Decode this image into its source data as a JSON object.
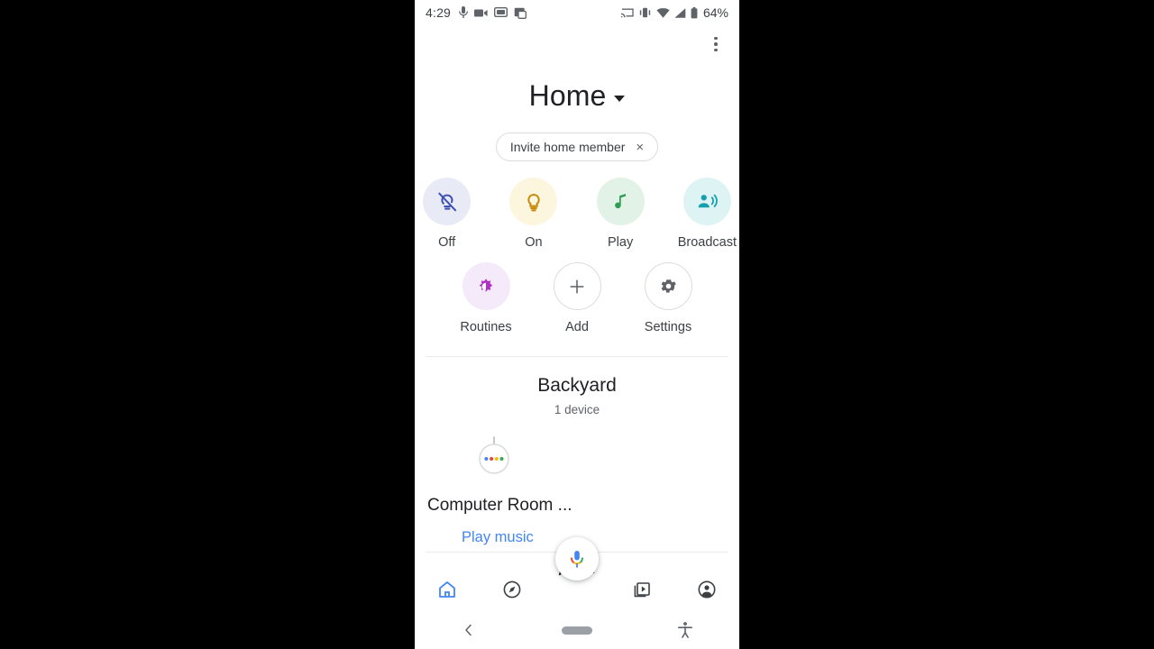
{
  "statusbar": {
    "clock": "4:29",
    "battery_text": "64%",
    "left_icons": [
      "mic-muted-icon",
      "video-camera-icon",
      "screen-record-icon",
      "screenshot-icon"
    ],
    "right_icons": [
      "cast-icon",
      "vibrate-icon",
      "wifi-icon",
      "cellular-signal-icon",
      "battery-icon"
    ]
  },
  "header": {
    "overflow_label": "more-options",
    "title": "Home",
    "caret": "chevron-down-icon"
  },
  "invite_chip": {
    "label": "Invite home member",
    "close": "×"
  },
  "quick_actions_row1": [
    {
      "label": "Off",
      "icon": "lightbulb-off-icon",
      "bg": "#e8ebf5",
      "fg": "#3f51b5"
    },
    {
      "label": "On",
      "icon": "lightbulb-on-icon",
      "bg": "#fdf6de",
      "fg": "#c8890a"
    },
    {
      "label": "Play",
      "icon": "music-note-icon",
      "bg": "#e3f2e7",
      "fg": "#2e9e52"
    },
    {
      "label": "Broadcast",
      "icon": "person-speaking-icon",
      "bg": "#def3f4",
      "fg": "#16a0ae"
    }
  ],
  "quick_actions_row2": [
    {
      "label": "Routines",
      "icon": "routines-brightness-icon",
      "bg": "#f4eafa",
      "fg": "#b02fc4",
      "outline": false
    },
    {
      "label": "Add",
      "icon": "plus-icon",
      "bg": "#ffffff",
      "fg": "#5f6368",
      "outline": true
    },
    {
      "label": "Settings",
      "icon": "gear-icon",
      "bg": "#ffffff",
      "fg": "#5f6368",
      "outline": true
    }
  ],
  "room": {
    "title": "Backyard",
    "subtitle": "1 device"
  },
  "device": {
    "icon": "google-assistant-speaker-icon",
    "dot_colors": [
      "#4285f4",
      "#ea4335",
      "#fbbc05",
      "#34a853"
    ],
    "name": "Computer Room ...",
    "action": "Play music"
  },
  "fab": {
    "icon": "google-assistant-mic-icon",
    "clipped_text": "AU K"
  },
  "bottom_nav": [
    {
      "name": "home",
      "icon": "home-icon",
      "active": true,
      "color": "#4285f4"
    },
    {
      "name": "explore",
      "icon": "compass-icon",
      "active": false,
      "color": "#3c4043"
    },
    {
      "name": "media",
      "icon": "media-library-icon",
      "active": false,
      "color": "#3c4043"
    },
    {
      "name": "account",
      "icon": "account-circle-icon",
      "active": false,
      "color": "#3c4043"
    }
  ],
  "system_nav": {
    "back": "back-chevron-icon",
    "home": "home-pill-icon",
    "accessibility": "accessibility-icon"
  }
}
